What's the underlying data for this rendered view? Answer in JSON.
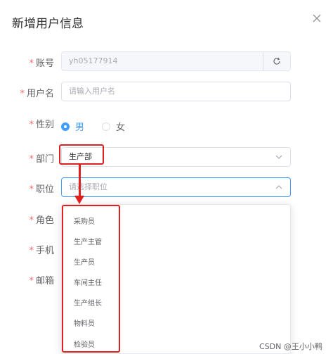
{
  "dialog": {
    "title": "新增用户信息"
  },
  "form": {
    "account": {
      "label": "账号",
      "value": "yh05177914"
    },
    "username": {
      "label": "用户名",
      "placeholder": "请输入用户名"
    },
    "gender": {
      "label": "性别",
      "options": [
        "男",
        "女"
      ],
      "selected": "男"
    },
    "department": {
      "label": "部门",
      "value": "生产部"
    },
    "position": {
      "label": "职位",
      "placeholder": "请选择职位"
    },
    "role": {
      "label": "角色"
    },
    "phone": {
      "label": "手机"
    },
    "email": {
      "label": "邮箱"
    }
  },
  "position_options": [
    "采购员",
    "生产主管",
    "生产员",
    "车间主任",
    "生产组长",
    "物料员",
    "检验员"
  ],
  "icons": {
    "close": "close-icon",
    "refresh": "refresh-icon",
    "chevron": "chevron-icon"
  },
  "colors": {
    "accent": "#409eff",
    "required": "#f56c6c",
    "annotation": "#e02020"
  },
  "watermark": "CSDN @王小小鸭"
}
